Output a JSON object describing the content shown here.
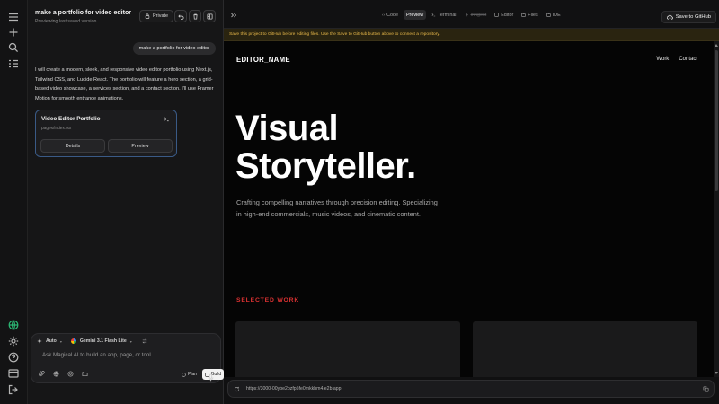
{
  "chat": {
    "title": "make a portfolio for video editor",
    "subtitle": "Previewing last saved version",
    "private_label": "Private",
    "user_message": "make a portfolio for video editor",
    "assistant_message": "I will create a modern, sleek, and responsive video editor portfolio using Next.js, Tailwind CSS, and Lucide React. The portfolio will feature a hero section, a grid-based video showcase, a services section, and a contact section. I'll use Framer Motion for smooth entrance animations.",
    "artifact": {
      "title": "Video Editor Portfolio",
      "path": "pages/index.tsx",
      "details_label": "Details",
      "preview_label": "Preview"
    }
  },
  "composer": {
    "mode": "Auto",
    "model": "Gemini 3.1 Flash Lite",
    "placeholder": "Ask Magical AI to build an app, page, or tool...",
    "plan_label": "Plan",
    "build_label": "Build"
  },
  "toolbar": {
    "tabs": [
      {
        "label": "Code",
        "icon": "code-icon"
      },
      {
        "label": "Preview",
        "icon": "eye-icon"
      },
      {
        "label": "Terminal",
        "icon": "terminal-icon"
      },
      {
        "label": "Inngest",
        "icon": "bolt-icon"
      },
      {
        "label": "Editor",
        "icon": "editor-icon"
      },
      {
        "label": "Files",
        "icon": "folder-icon"
      },
      {
        "label": "IDE",
        "icon": "ide-icon"
      }
    ],
    "active_tab": "Preview",
    "save_label": "Save to GitHub"
  },
  "banner": {
    "text": "Save this project to GitHub before editing files. Use the Save to GitHub button above to connect a repository.",
    "color": "#e9b94a"
  },
  "site": {
    "brand": "EDITOR_NAME",
    "nav": [
      "Work",
      "Contact"
    ],
    "hero_line1": "Visual",
    "hero_line2": "Storyteller.",
    "description": "Crafting compelling narratives through precision editing. Specializing in high-end commercials, music videos, and cinematic content.",
    "section_label": "SELECTED WORK",
    "accent_color": "#dc3232"
  },
  "url_bar": {
    "url": "https://3000-00ybe2bzfp5fe0mkkhm4.e2b.app"
  }
}
